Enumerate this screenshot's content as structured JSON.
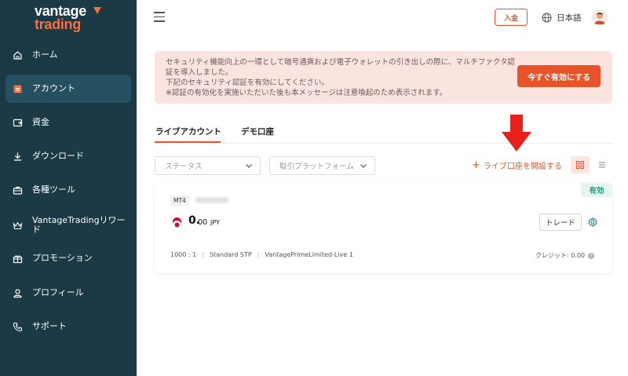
{
  "brand": {
    "line1": "vantage",
    "line2": "trading",
    "accent": "#ff6b3d"
  },
  "sidebar": {
    "bg": "#1b3a46",
    "items": [
      {
        "label": "ホーム",
        "icon": "home-icon"
      },
      {
        "label": "アカウント",
        "icon": "account-icon",
        "active": true
      },
      {
        "label": "資金",
        "icon": "funds-icon"
      },
      {
        "label": "ダウンロード",
        "icon": "download-icon"
      },
      {
        "label": "各種ツール",
        "icon": "toolbox-icon"
      },
      {
        "label": "VantageTradingリワード",
        "icon": "reward-icon"
      },
      {
        "label": "プロモーション",
        "icon": "gift-icon"
      },
      {
        "label": "プロフィール",
        "icon": "profile-icon"
      },
      {
        "label": "サポート",
        "icon": "phone-icon"
      }
    ]
  },
  "header": {
    "deposit_label": "入金",
    "language_label": "日本語"
  },
  "banner": {
    "lines": [
      "セキュリティ機能向上の一環として暗号通貨および電子ウォレットの引き出しの際に、マルチファクタ認証を導入しました。",
      "下記のセキュリティ認証を有効にしてください。",
      "※認証の有効化を実施いただいた後も本メッセージは注意喚起のため表示されます。"
    ],
    "button_label": "今すぐ有効にする"
  },
  "tabs": [
    {
      "label": "ライブアカウント",
      "active": true
    },
    {
      "label": "デモ口座",
      "active": false
    }
  ],
  "filters": {
    "status_placeholder": "ステータス",
    "platform_placeholder": "取引プラットフォーム"
  },
  "actions": {
    "open_live_label": "ライブ口座を開設する"
  },
  "account_card": {
    "platform": "MT4",
    "status": "有効",
    "balance_int": "0.",
    "balance_dec": "00",
    "currency": "JPY",
    "trade_label": "トレード",
    "leverage": "1000 : 1",
    "account_type": "Standard STP",
    "server": "VantagePrimeLimited-Live 1",
    "credit_label": "クレジット: 0.00"
  },
  "colors": {
    "accent": "#e8542a",
    "status_green": "#2a9d7a",
    "banner_bg": "#fbe3e0"
  }
}
